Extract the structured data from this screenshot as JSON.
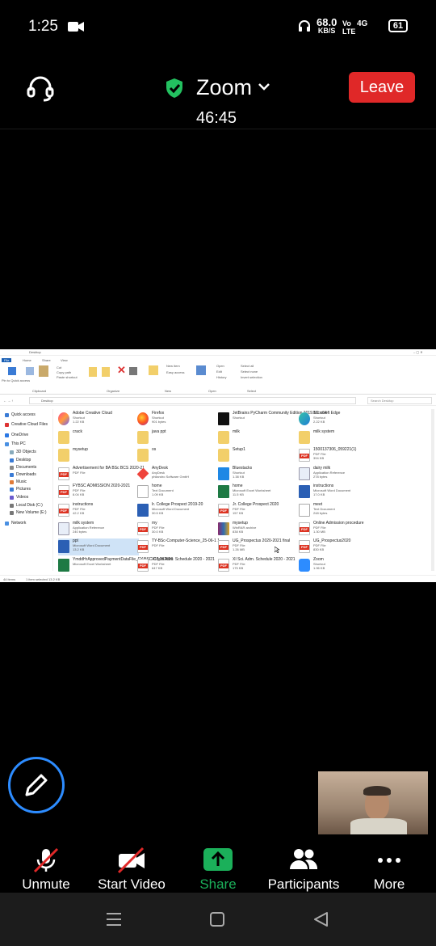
{
  "status_bar": {
    "time": "1:25",
    "net_speed": "68.0",
    "net_unit": "KB/S",
    "volte": "Vo LTE",
    "signal": "4G",
    "battery": "61"
  },
  "meeting": {
    "title": "Zoom",
    "timer": "46:45",
    "leave_label": "Leave"
  },
  "explorer": {
    "title_path": "Desktop",
    "ribbon_tabs": [
      "File",
      "Home",
      "Share",
      "View"
    ],
    "ribbon_groups": [
      "Clipboard",
      "Organize",
      "New",
      "Open",
      "Select"
    ],
    "ribbon_buttons": [
      "Pin to Quick access",
      "Copy",
      "Paste",
      "Cut",
      "Copy path",
      "Paste shortcut",
      "Move to",
      "Copy to",
      "Delete",
      "Rename",
      "New folder",
      "New item",
      "Easy access",
      "Properties",
      "Open",
      "Edit",
      "History",
      "Select all",
      "Select none",
      "Invert selection"
    ],
    "address": "Desktop",
    "search_placeholder": "Search Desktop",
    "nav_items": [
      "Quick access",
      "Creative Cloud Files",
      "OneDrive",
      "This PC",
      "3D Objects",
      "Desktop",
      "Documents",
      "Downloads",
      "Music",
      "Pictures",
      "Videos",
      "Local Disk (C:)",
      "New Volume (E:)",
      "Network"
    ],
    "files": [
      {
        "name": "Adobe Creative Cloud",
        "type": "Shortcut",
        "size": "1.22 KB",
        "icon": "cc"
      },
      {
        "name": "Firefox",
        "type": "Shortcut",
        "size": "901 bytes",
        "icon": "firefox"
      },
      {
        "name": "JetBrains PyCharm Community Edition 2019.1.1 x64",
        "type": "Shortcut",
        "size": "",
        "icon": "pycharm"
      },
      {
        "name": "Microsoft Edge",
        "type": "Shortcut",
        "size": "2.22 KB",
        "icon": "edge"
      },
      {
        "name": "crack",
        "type": "",
        "size": "",
        "icon": "folder"
      },
      {
        "name": "java ppt",
        "type": "",
        "size": "",
        "icon": "folder"
      },
      {
        "name": "milk",
        "type": "",
        "size": "",
        "icon": "folder"
      },
      {
        "name": "milk system",
        "type": "",
        "size": "",
        "icon": "folder"
      },
      {
        "name": "mysetup",
        "type": "",
        "size": "",
        "icon": "folder"
      },
      {
        "name": "os",
        "type": "",
        "size": "",
        "icon": "folder"
      },
      {
        "name": "Setup1",
        "type": "",
        "size": "",
        "icon": "folder"
      },
      {
        "name": "1500137306_059221(1)",
        "type": "PDF File",
        "size": "394 KB",
        "icon": "pdf"
      },
      {
        "name": "Advertisement for BA BSc BCS 2020-21",
        "type": "PDF File",
        "size": "",
        "icon": "pdf"
      },
      {
        "name": "AnyDesk",
        "type": "AnyDesk",
        "size": "philandro Software GmbH",
        "icon": "anydesk"
      },
      {
        "name": "Bluestacks",
        "type": "Shortcut",
        "size": "1.38 KB",
        "icon": "bluestacks"
      },
      {
        "name": "dairy milk",
        "type": "Application Reference",
        "size": "278 bytes",
        "icon": "app"
      },
      {
        "name": "FYBSC ADMISSION 2020-2021",
        "type": "PDF File",
        "size": "8.04 KB",
        "icon": "pdf"
      },
      {
        "name": "home",
        "type": "Text Document",
        "size": "1.09 KB",
        "icon": "txt"
      },
      {
        "name": "home",
        "type": "Microsoft Excel Worksheet",
        "size": "11.5 KB",
        "icon": "xls"
      },
      {
        "name": "instructions",
        "type": "Microsoft Word Document",
        "size": "17.0 KB",
        "icon": "doc"
      },
      {
        "name": "instructions",
        "type": "PDF File",
        "size": "42.2 KB",
        "icon": "pdf"
      },
      {
        "name": "Ir. College Prospect 2019-20",
        "type": "Microsoft Word Document",
        "size": "30.5 KB",
        "icon": "doc"
      },
      {
        "name": "Jr. College Prospect 2020",
        "type": "PDF File",
        "size": "157 KB",
        "icon": "pdf"
      },
      {
        "name": "meet",
        "type": "Text Document",
        "size": "248 bytes",
        "icon": "txt"
      },
      {
        "name": "milk system",
        "type": "Application Reference",
        "size": "240 bytes",
        "icon": "app"
      },
      {
        "name": "my",
        "type": "PDF File",
        "size": "30.0 KB",
        "icon": "pdf"
      },
      {
        "name": "mysetup",
        "type": "WinRAR archive",
        "size": "838 KB",
        "icon": "rar"
      },
      {
        "name": "Online Admission procedure",
        "type": "PDF File",
        "size": "1.30 MB",
        "icon": "pdf"
      },
      {
        "name": "ppt",
        "type": "Microsoft Word Document",
        "size": "13.2 KB",
        "icon": "doc"
      },
      {
        "name": "TY-BSc-Computer-Science_25-06-1 1",
        "type": "PDF File",
        "size": "",
        "icon": "pdf"
      },
      {
        "name": "UG_Prospectus 2020-2021 final",
        "type": "PDF File",
        "size": "1.26 MB",
        "icon": "pdf"
      },
      {
        "name": "UG_Prospectus2020",
        "type": "PDF File",
        "size": "830 KB",
        "icon": "pdf"
      },
      {
        "name": "YmddHrApprovedPaymentDataFile_FY.BSC-CI_282899",
        "type": "Microsoft Excel Worksheet",
        "size": "",
        "icon": "xls"
      },
      {
        "name": "XI Arts Adm. Schedule 2020 - 2021",
        "type": "PDF File",
        "size": "647 KB",
        "icon": "pdf"
      },
      {
        "name": "XI Sci. Adm. Schedule 2020 - 2021",
        "type": "PDF File",
        "size": "175 KB",
        "icon": "pdf"
      },
      {
        "name": "Zoom",
        "type": "Shortcut",
        "size": "1.96 KB",
        "icon": "zoom"
      }
    ],
    "status_items": "44 items",
    "status_selected": "1 item selected 13.2 KB"
  },
  "toolbar": {
    "unmute": "Unmute",
    "start_video": "Start Video",
    "share": "Share",
    "participants": "Participants",
    "more": "More"
  },
  "colors": {
    "accent": "#2d8cff",
    "share_green": "#1bb05a",
    "leave_red": "#e02828",
    "shield_green": "#23c160"
  }
}
